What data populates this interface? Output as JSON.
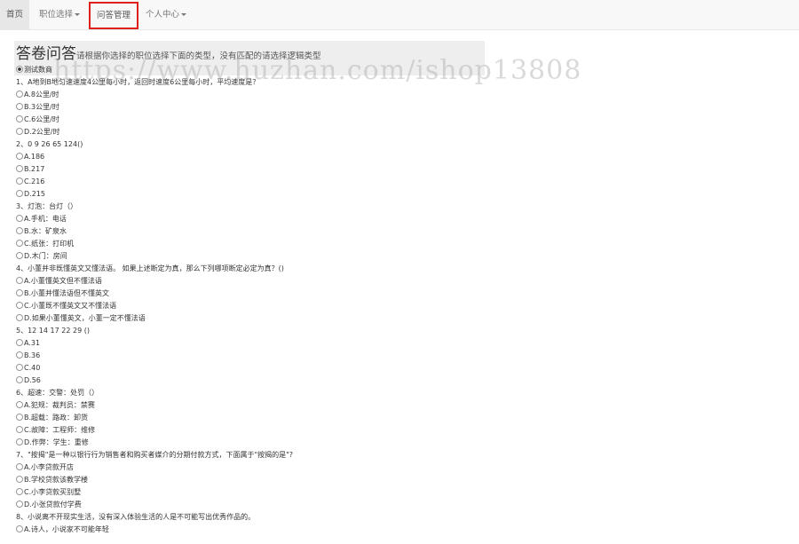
{
  "nav": {
    "home": "首页",
    "position_select": "职位选择",
    "qa_manage": "问答管理",
    "personal_center": "个人中心"
  },
  "header": {
    "title": "答卷问答",
    "subtitle": "请根据你选择的职位选择下面的类型，没有匹配的请选择逻辑类型",
    "category_label": "测试数商"
  },
  "watermark": "https://www.huzhan.com/ishop13808",
  "questions": [
    {
      "text": "1、A地到B地匀速速度4公里每小时，返回时速度6公里每小时，平均速度是？",
      "options": [
        "A.8公里/时",
        "B.3公里/时",
        "C.6公里/时",
        "D.2公里/时"
      ]
    },
    {
      "text": "2、0 9 26 65 124()",
      "options": [
        "A.186",
        "B.217",
        "C.216",
        "D.215"
      ]
    },
    {
      "text": "3、灯泡：台灯（）",
      "options": [
        "A.手机：电话",
        "B.水：矿泉水",
        "C.纸张：打印机",
        "D.木门：房间"
      ]
    },
    {
      "text": "4、小董并非既懂英文又懂法语。 如果上述断定为真，那么下列哪项断定必定为真？()",
      "options": [
        "A.小董懂英文但不懂法语",
        "B.小董并懂法语但不懂英文",
        "C.小董既不懂英文又不懂法语",
        "D.如果小董懂英文，小董一定不懂法语"
      ]
    },
    {
      "text": "5、12 14 17 22 29 ()",
      "options": [
        "A.31",
        "B.36",
        "C.40",
        "D.56"
      ]
    },
    {
      "text": "6、超速：交警：处罚（）",
      "options": [
        "A.犯规：裁判员：禁赛",
        "B.超载：路政：卸货",
        "C.故障：工程师：维修",
        "D.作弊：学生：重修"
      ]
    },
    {
      "text": "7、\"按揭\"是一种以银行行为销售者和购买者媒介的分期付款方式，下面属于\"按揭的是\"?",
      "options": [
        "A.小李贷款开店",
        "B.学校贷款该教学楼",
        "C.小李贷款买别墅",
        "D.小张贷款付学费"
      ]
    },
    {
      "text": "8、小说离不开现实生活，没有深入体验生活的人是不可能写出优秀作品的。",
      "options": [
        "A.诗人，小说家不可能年轻"
      ]
    }
  ]
}
